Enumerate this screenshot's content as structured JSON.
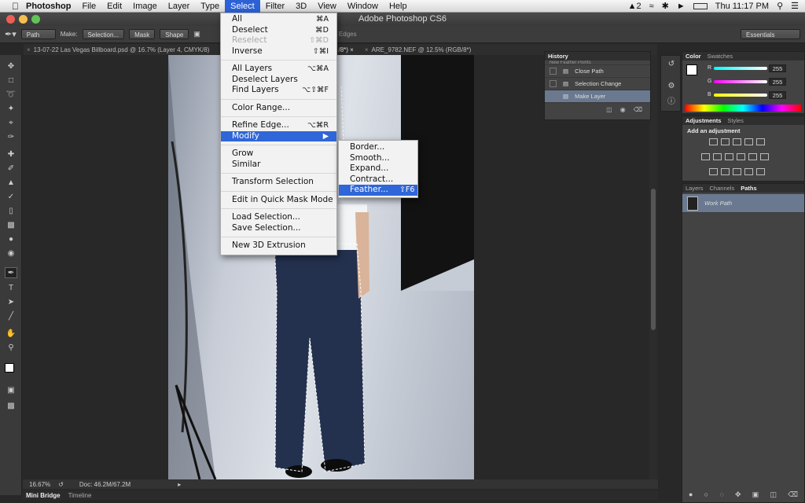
{
  "menubar": {
    "app_name": "Photoshop",
    "menus": [
      "File",
      "Edit",
      "Image",
      "Layer",
      "Type",
      "Select",
      "Filter",
      "3D",
      "View",
      "Window",
      "Help"
    ],
    "active_menu": "Select",
    "status_items": {
      "adobe_badge": "2",
      "battery": "",
      "clock": "Thu 11:17 PM"
    }
  },
  "window": {
    "title": "Adobe Photoshop CS6"
  },
  "options": {
    "mode": "Path",
    "make_label": "Make:",
    "selection_btn": "Selection...",
    "mask_btn": "Mask",
    "shape_btn": "Shape",
    "align_edges": "Align Edges",
    "workspace": "Essentials"
  },
  "doc_tabs": [
    "13-07-22 Las Vegas Billboard.psd @ 16.7% (Layer 4, CMYK/8)",
    "/8*) ×",
    "ARE_9782.NEF @ 12.5% (RGB/8*)"
  ],
  "status": {
    "zoom": "16.67%",
    "doc": "Doc: 46.2M/67.2M"
  },
  "bottom_tabs": [
    "Mini Bridge",
    "Timeline"
  ],
  "history": {
    "title": "History",
    "items": [
      "Close Path",
      "Selection Change",
      "Make Layer"
    ],
    "partial_item": "New Feather Points"
  },
  "color_panel": {
    "tabs": [
      "Color",
      "Swatches"
    ],
    "channels": [
      {
        "label": "R",
        "value": "255"
      },
      {
        "label": "G",
        "value": "255"
      },
      {
        "label": "B",
        "value": "255"
      }
    ]
  },
  "adjustments": {
    "tabs": [
      "Adjustments",
      "Styles"
    ],
    "add_label": "Add an adjustment"
  },
  "paths_panel": {
    "tabs": [
      "Layers",
      "Channels",
      "Paths"
    ],
    "items": [
      "Work Path"
    ]
  },
  "select_menu": {
    "items": [
      {
        "label": "All",
        "shortcut": "⌘A"
      },
      {
        "label": "Deselect",
        "shortcut": "⌘D"
      },
      {
        "label": "Reselect",
        "shortcut": "⇧⌘D",
        "disabled": true
      },
      {
        "label": "Inverse",
        "shortcut": "⇧⌘I"
      },
      {
        "label": "All Layers",
        "shortcut": "⌥⌘A"
      },
      {
        "label": "Deselect Layers",
        "shortcut": ""
      },
      {
        "label": "Find Layers",
        "shortcut": "⌥⇧⌘F"
      },
      {
        "label": "Color Range...",
        "shortcut": ""
      },
      {
        "label": "Refine Edge...",
        "shortcut": "⌥⌘R"
      },
      {
        "label": "Modify",
        "shortcut": "▶",
        "highlighted": true
      },
      {
        "label": "Grow",
        "shortcut": ""
      },
      {
        "label": "Similar",
        "shortcut": ""
      },
      {
        "label": "Transform Selection",
        "shortcut": ""
      },
      {
        "label": "Edit in Quick Mask Mode",
        "shortcut": ""
      },
      {
        "label": "Load Selection...",
        "shortcut": ""
      },
      {
        "label": "Save Selection...",
        "shortcut": ""
      },
      {
        "label": "New 3D Extrusion",
        "shortcut": ""
      }
    ]
  },
  "modify_submenu": {
    "items": [
      {
        "label": "Border...",
        "shortcut": ""
      },
      {
        "label": "Smooth...",
        "shortcut": ""
      },
      {
        "label": "Expand...",
        "shortcut": ""
      },
      {
        "label": "Contract...",
        "shortcut": ""
      },
      {
        "label": "Feather...",
        "shortcut": "⇧F6",
        "highlighted": true
      }
    ]
  }
}
